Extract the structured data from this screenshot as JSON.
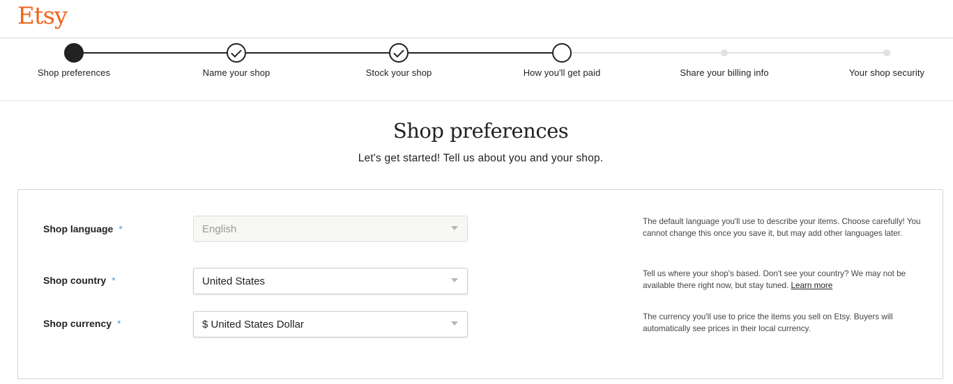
{
  "header": {
    "logo": "Etsy"
  },
  "stepper": {
    "steps": [
      {
        "label": "Shop preferences",
        "state": "current"
      },
      {
        "label": "Name your shop",
        "state": "complete"
      },
      {
        "label": "Stock your shop",
        "state": "complete"
      },
      {
        "label": "How you'll get paid",
        "state": "active"
      },
      {
        "label": "Share your billing info",
        "state": "upcoming"
      },
      {
        "label": "Your shop security",
        "state": "upcoming"
      }
    ]
  },
  "main": {
    "title": "Shop preferences",
    "subtitle": "Let's get started! Tell us about you and your shop."
  },
  "form": {
    "required_marker": "*",
    "fields": [
      {
        "label": "Shop language",
        "value": "English",
        "disabled": true,
        "help": "The default language you'll use to describe your items. Choose carefully! You cannot change this once you save it, but may add other languages later."
      },
      {
        "label": "Shop country",
        "value": "United States",
        "disabled": false,
        "help": "Tell us where your shop's based. Don't see your country? We may not be available there right now, but stay tuned.",
        "help_link": "Learn more"
      },
      {
        "label": "Shop currency",
        "value": "$ United States Dollar",
        "disabled": false,
        "help": "The currency you'll use to price the items you sell on Etsy. Buyers will automatically see prices in their local currency."
      }
    ]
  },
  "colors": {
    "brand": "#f1641e",
    "required": "#4d9dd1",
    "progress": "#222222",
    "progress_todo": "#e1e1e1"
  }
}
